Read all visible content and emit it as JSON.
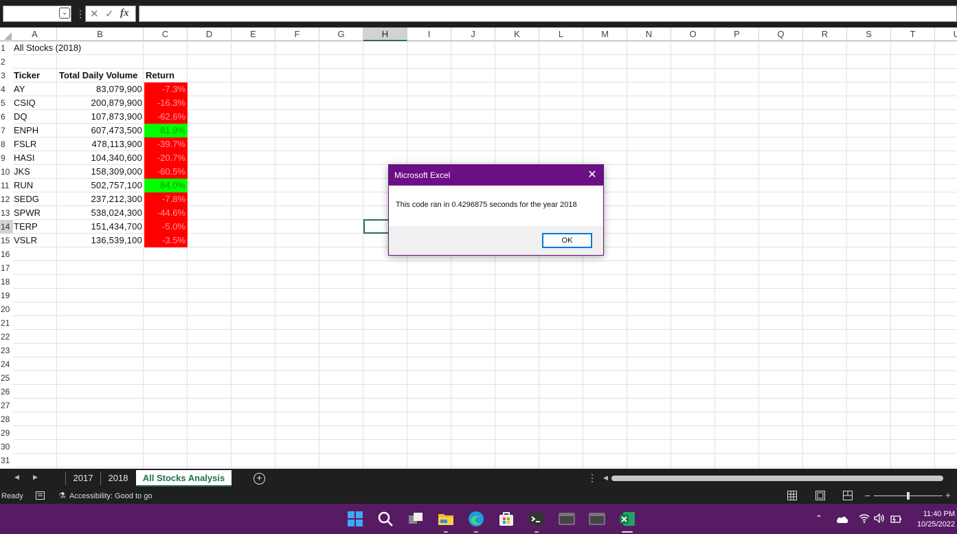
{
  "formula_bar": {
    "name_box": "",
    "formula": "",
    "fx_label": "fx"
  },
  "columns": [
    "A",
    "B",
    "C",
    "D",
    "E",
    "F",
    "G",
    "H",
    "I",
    "J",
    "K",
    "L",
    "M",
    "N",
    "O",
    "P",
    "Q",
    "R",
    "S",
    "T",
    "U"
  ],
  "selected_column": "H",
  "selected_row": "14",
  "rows": [
    "1",
    "2",
    "3",
    "4",
    "5",
    "6",
    "7",
    "8",
    "9",
    "10",
    "11",
    "12",
    "13",
    "14",
    "15",
    "16",
    "17",
    "18",
    "19",
    "20",
    "21",
    "22",
    "23",
    "24",
    "25",
    "26",
    "27",
    "28",
    "29",
    "30",
    "31"
  ],
  "sheet": {
    "title": "All Stocks (2018)",
    "headers": {
      "ticker": "Ticker",
      "volume": "Total Daily Volume",
      "return": "Return"
    },
    "stocks": [
      {
        "ticker": "AY",
        "volume": "83,079,900",
        "return": "-7.3%",
        "positive": false
      },
      {
        "ticker": "CSIQ",
        "volume": "200,879,900",
        "return": "-16.3%",
        "positive": false
      },
      {
        "ticker": "DQ",
        "volume": "107,873,900",
        "return": "-62.6%",
        "positive": false
      },
      {
        "ticker": "ENPH",
        "volume": "607,473,500",
        "return": "81.9%",
        "positive": true
      },
      {
        "ticker": "FSLR",
        "volume": "478,113,900",
        "return": "-39.7%",
        "positive": false
      },
      {
        "ticker": "HASI",
        "volume": "104,340,600",
        "return": "-20.7%",
        "positive": false
      },
      {
        "ticker": "JKS",
        "volume": "158,309,000",
        "return": "-60.5%",
        "positive": false
      },
      {
        "ticker": "RUN",
        "volume": "502,757,100",
        "return": "84.0%",
        "positive": true
      },
      {
        "ticker": "SEDG",
        "volume": "237,212,300",
        "return": "-7.8%",
        "positive": false
      },
      {
        "ticker": "SPWR",
        "volume": "538,024,300",
        "return": "-44.6%",
        "positive": false
      },
      {
        "ticker": "TERP",
        "volume": "151,434,700",
        "return": "-5.0%",
        "positive": false
      },
      {
        "ticker": "VSLR",
        "volume": "136,539,100",
        "return": "-3.5%",
        "positive": false
      }
    ],
    "colors": {
      "positive": "#00ff00",
      "negative": "#ff0000"
    }
  },
  "dialog": {
    "title": "Microsoft Excel",
    "message": "This code ran in 0.4296875 seconds for the year 2018",
    "ok_label": "OK"
  },
  "tabs": [
    "2017",
    "2018",
    "All Stocks Analysis"
  ],
  "active_tab": "All Stocks Analysis",
  "status": {
    "ready": "Ready",
    "accessibility": "Accessibility: Good to go"
  },
  "taskbar": {
    "time": "11:40 PM",
    "date": "10/25/2022",
    "icons": [
      "windows-start-icon",
      "search-icon",
      "task-view-icon",
      "file-explorer-icon",
      "edge-icon",
      "store-icon",
      "terminal-icon",
      "app-window-icon",
      "app-window-icon",
      "excel-icon"
    ]
  },
  "theme": {
    "excel_green": "#217346",
    "dialog_purple": "#6b0f84",
    "taskbar_purple": "#561b63"
  }
}
